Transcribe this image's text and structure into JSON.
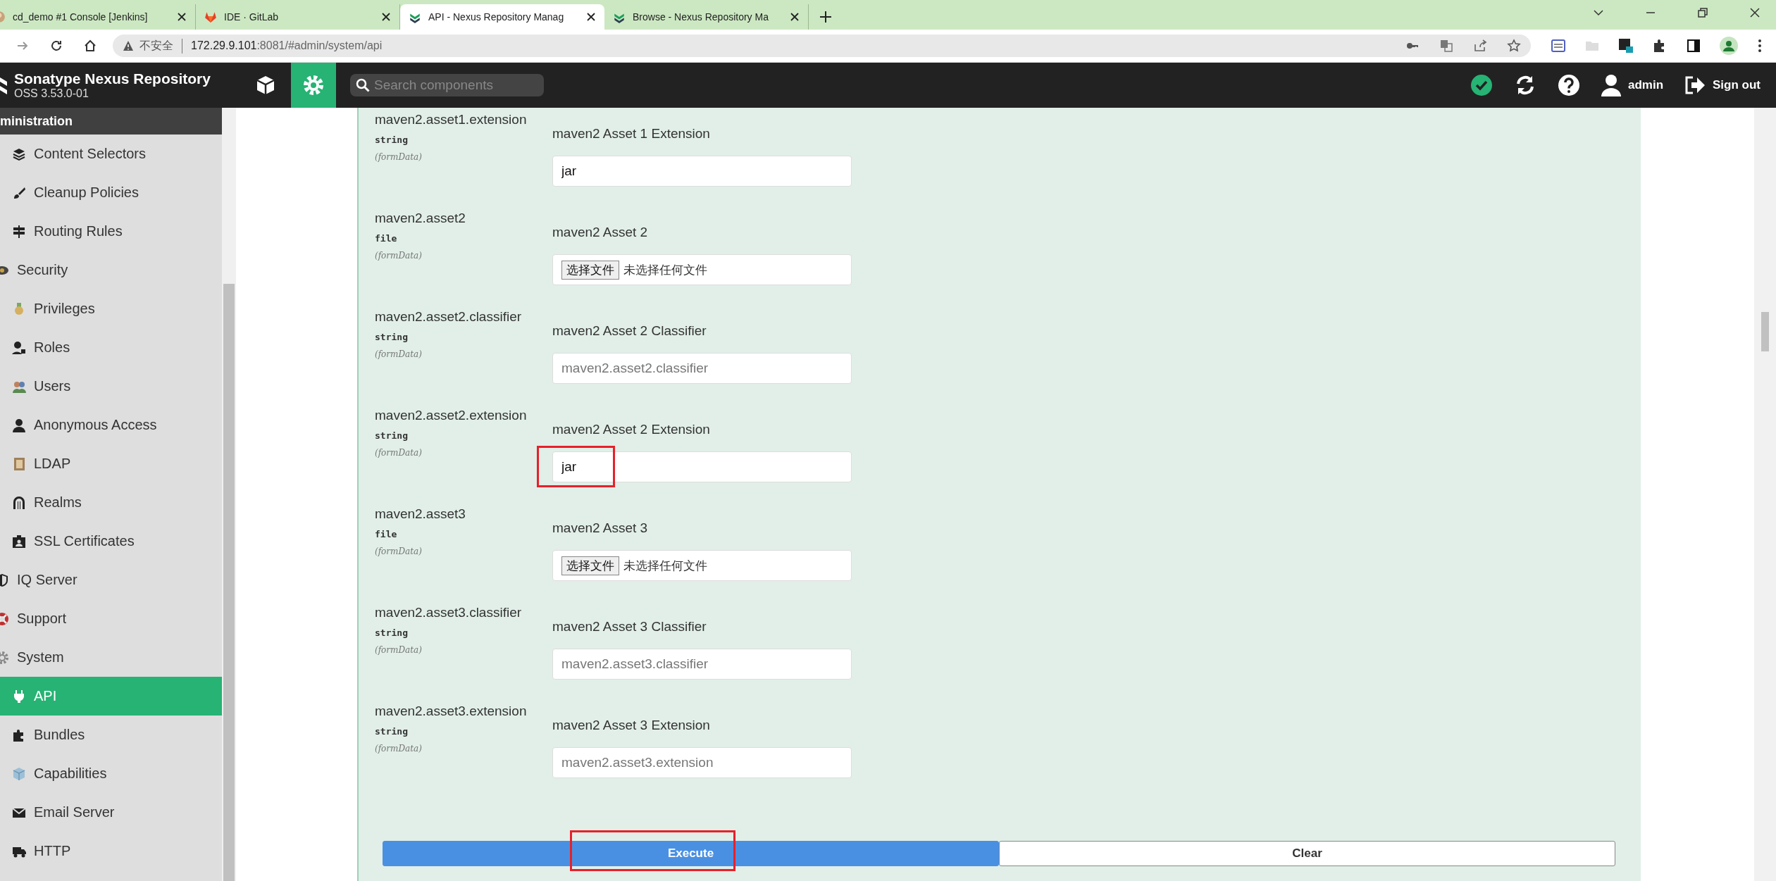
{
  "browser": {
    "tabs": [
      {
        "label": "cd_demo #1 Console [Jenkins]",
        "selected": false
      },
      {
        "label": "IDE · GitLab",
        "selected": false
      },
      {
        "label": "API - Nexus Repository Manag",
        "selected": true
      },
      {
        "label": "Browse - Nexus Repository Ma",
        "selected": false
      }
    ],
    "security_label": "不安全",
    "url_host": "172.29.9.101",
    "url_path": ":8081/#admin/system/api"
  },
  "header": {
    "title": "Sonatype Nexus Repository",
    "version": "OSS 3.53.0-01",
    "search": {
      "placeholder": "Search components"
    },
    "user": "admin",
    "sign_out": "Sign out"
  },
  "sidebar": {
    "heading": "ministration",
    "items": [
      {
        "children": [
          {
            "label": "Content Selectors",
            "selected": false
          },
          {
            "label": "Cleanup Policies",
            "selected": false
          },
          {
            "label": "Routing Rules",
            "selected": false
          }
        ]
      },
      {
        "label": "Security",
        "selected": false,
        "children": [
          {
            "label": "Privileges",
            "selected": false
          },
          {
            "label": "Roles",
            "selected": false
          },
          {
            "label": "Users",
            "selected": false
          },
          {
            "label": "Anonymous Access",
            "selected": false
          },
          {
            "label": "LDAP",
            "selected": false
          },
          {
            "label": "Realms",
            "selected": false
          },
          {
            "label": "SSL Certificates",
            "selected": false
          }
        ]
      },
      {
        "label": "IQ Server",
        "selected": false
      },
      {
        "label": "Support",
        "selected": false
      },
      {
        "label": "System",
        "selected": false,
        "children": [
          {
            "label": "API",
            "selected": true
          },
          {
            "label": "Bundles",
            "selected": false
          },
          {
            "label": "Capabilities",
            "selected": false
          },
          {
            "label": "Email Server",
            "selected": false
          },
          {
            "label": "HTTP",
            "selected": false
          }
        ]
      }
    ]
  },
  "params": [
    {
      "name": "maven2.asset1.extension",
      "type": "string",
      "location": "(formData)",
      "description": "maven2 Asset 1 Extension",
      "kind": "text",
      "value": "jar",
      "highlighted": false
    },
    {
      "name": "maven2.asset2",
      "type": "file",
      "location": "(formData)",
      "description": "maven2 Asset 2",
      "kind": "file",
      "button": "选择文件",
      "status": "未选择任何文件",
      "highlighted": false
    },
    {
      "name": "maven2.asset2.classifier",
      "type": "string",
      "location": "(formData)",
      "description": "maven2 Asset 2 Classifier",
      "kind": "text",
      "placeholder": "maven2.asset2.classifier",
      "highlighted": false
    },
    {
      "name": "maven2.asset2.extension",
      "type": "string",
      "location": "(formData)",
      "description": "maven2 Asset 2 Extension",
      "kind": "text",
      "value": "jar",
      "highlighted": true
    },
    {
      "name": "maven2.asset3",
      "type": "file",
      "location": "(formData)",
      "description": "maven2 Asset 3",
      "kind": "file",
      "button": "选择文件",
      "status": "未选择任何文件",
      "highlighted": false
    },
    {
      "name": "maven2.asset3.classifier",
      "type": "string",
      "location": "(formData)",
      "description": "maven2 Asset 3 Classifier",
      "kind": "text",
      "placeholder": "maven2.asset3.classifier",
      "highlighted": false
    },
    {
      "name": "maven2.asset3.extension",
      "type": "string",
      "location": "(formData)",
      "description": "maven2 Asset 3 Extension",
      "kind": "text",
      "placeholder": "maven2.asset3.extension",
      "highlighted": false
    }
  ],
  "actions": [
    {
      "label": "Execute",
      "kind": "primary",
      "highlighted": true
    },
    {
      "label": "Clear",
      "kind": "secondary",
      "highlighted": false
    }
  ]
}
